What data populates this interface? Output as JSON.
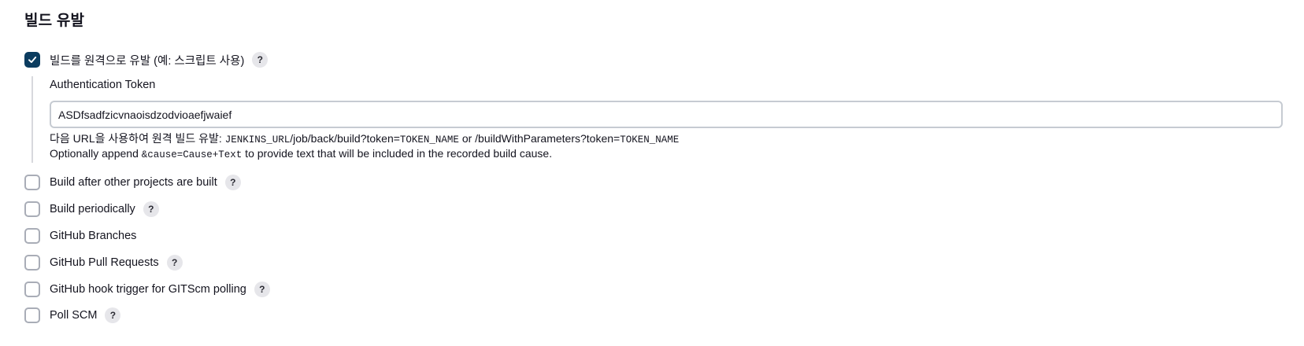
{
  "section": {
    "title": "빌드 유발"
  },
  "remote_trigger": {
    "label": "빌드를 원격으로 유발 (예: 스크립트 사용)",
    "checked": true,
    "help": "?",
    "token_label": "Authentication Token",
    "token_value": "ASDfsadfzicvnaoisdzodvioaefjwaief",
    "url_desc": {
      "prefix": "다음 URL을 사용하여 원격 빌드 유발: ",
      "jenkins_url": "JENKINS_URL",
      "path1": "/job/back/build?token=",
      "token_name1": "TOKEN_NAME",
      "or_text": " or /buildWithParameters?token=",
      "token_name2": "TOKEN_NAME"
    },
    "cause_desc": {
      "prefix": "Optionally append ",
      "code": "&cause=Cause+Text",
      "suffix": " to provide text that will be included in the recorded build cause."
    }
  },
  "triggers": [
    {
      "label": "Build after other projects are built",
      "checked": false,
      "help": "?"
    },
    {
      "label": "Build periodically",
      "checked": false,
      "help": "?"
    },
    {
      "label": "GitHub Branches",
      "checked": false,
      "help": ""
    },
    {
      "label": "GitHub Pull Requests",
      "checked": false,
      "help": "?"
    },
    {
      "label": "GitHub hook trigger for GITScm polling",
      "checked": false,
      "help": "?"
    },
    {
      "label": "Poll SCM",
      "checked": false,
      "help": "?"
    }
  ],
  "icons": {
    "checkmark": "check-icon",
    "help": "help-icon"
  },
  "colors": {
    "checked_fill": "#0b3c5f",
    "checkbox_border": "#a9adb7",
    "help_bg": "#e6e6ea",
    "input_border": "#c6cbd2"
  }
}
